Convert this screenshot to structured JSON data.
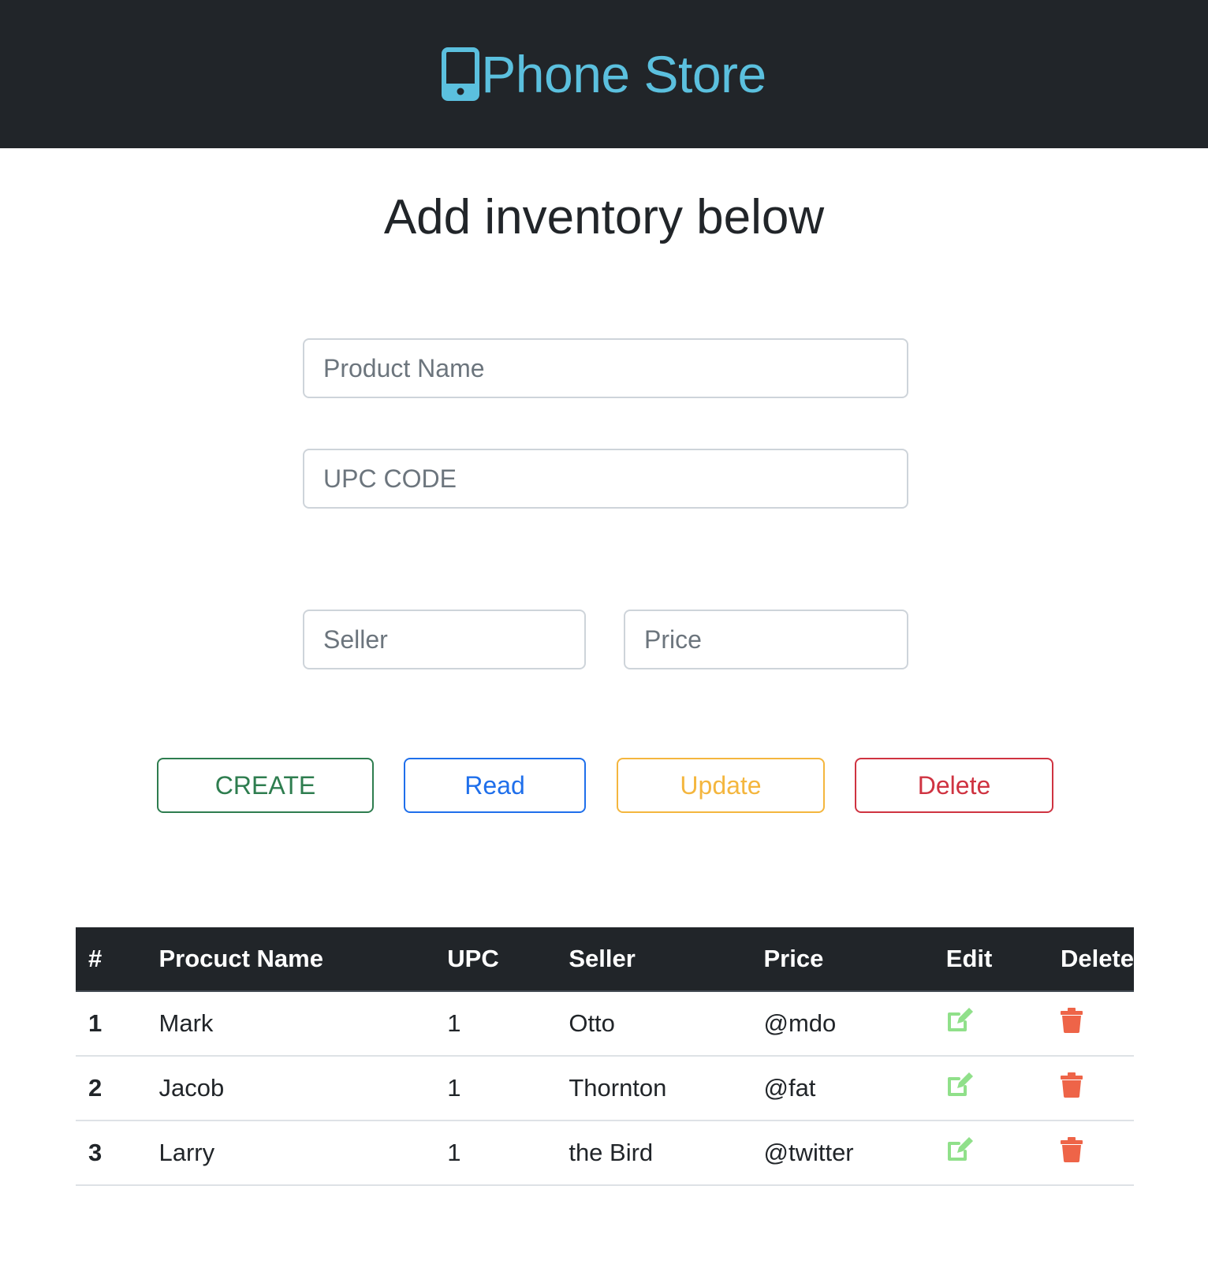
{
  "navbar": {
    "brand_icon": "mobile-phone-icon",
    "brand_text": "Phone Store",
    "brand_color": "#5bc0de",
    "background": "#212529"
  },
  "heading": "Add inventory below",
  "form": {
    "product_name": {
      "value": "",
      "placeholder": "Product Name"
    },
    "upc_code": {
      "value": "",
      "placeholder": "UPC CODE"
    },
    "seller": {
      "value": "",
      "placeholder": "Seller"
    },
    "price": {
      "value": "",
      "placeholder": "Price"
    }
  },
  "buttons": {
    "create": {
      "label": "CREATE",
      "color": "#2e7d4f"
    },
    "read": {
      "label": "Read",
      "color": "#1f6feb"
    },
    "update": {
      "label": "Update",
      "color": "#f4b63e"
    },
    "delete": {
      "label": "Delete",
      "color": "#cf3341"
    }
  },
  "table": {
    "headers": [
      "#",
      "Procuct Name",
      "UPC",
      "Seller",
      "Price",
      "Edit",
      "Delete"
    ],
    "rows": [
      {
        "num": "1",
        "name": "Mark",
        "upc": "1",
        "seller": "Otto",
        "price": "@mdo"
      },
      {
        "num": "2",
        "name": "Jacob",
        "upc": "1",
        "seller": "Thornton",
        "price": "@fat"
      },
      {
        "num": "3",
        "name": "Larry",
        "upc": "1",
        "seller": "the Bird",
        "price": "@twitter"
      }
    ],
    "edit_icon": "edit-icon",
    "edit_icon_color": "#90e08a",
    "delete_icon": "trash-icon",
    "delete_icon_color": "#ee6448"
  }
}
